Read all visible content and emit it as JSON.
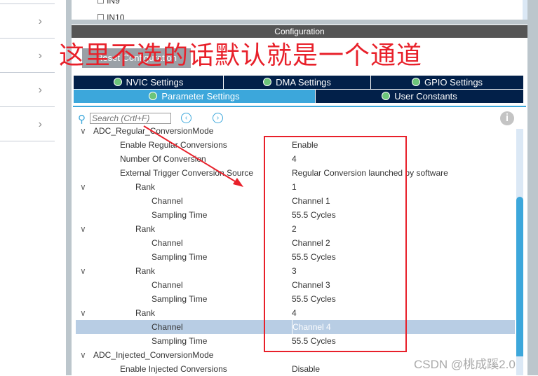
{
  "left_panel": {
    "items": [
      {
        "icon": "chevron-right"
      },
      {
        "icon": "chevron-right"
      },
      {
        "icon": "chevron-right"
      },
      {
        "icon": "chevron-right"
      }
    ]
  },
  "top_list": {
    "items": [
      "IN9",
      "IN10"
    ]
  },
  "config": {
    "title": "Configuration",
    "reset_button": "Reset Configuration"
  },
  "annotation": {
    "text": "这里不选的话默认就是一个通道",
    "color": "#e8202a"
  },
  "tabs": [
    {
      "label": "NVIC Settings"
    },
    {
      "label": "DMA Settings"
    },
    {
      "label": "GPIO Settings"
    },
    {
      "label": "Parameter Settings",
      "active": true
    },
    {
      "label": "User Constants"
    }
  ],
  "search": {
    "placeholder": "Search (Crtl+F)"
  },
  "rows": [
    {
      "key": "ADC_Regular_ConversionMode",
      "value": "",
      "level": 0,
      "toggle": true
    },
    {
      "key": "Enable Regular Conversions",
      "value": "Enable",
      "level": 1
    },
    {
      "key": "Number Of Conversion",
      "value": "4",
      "level": 1
    },
    {
      "key": "External Trigger Conversion Source",
      "value": "Regular Conversion launched by software",
      "level": 1
    },
    {
      "key": "Rank",
      "value": "1",
      "level": 2,
      "toggle": true
    },
    {
      "key": "Channel",
      "value": "Channel 1",
      "level": 3
    },
    {
      "key": "Sampling Time",
      "value": "55.5 Cycles",
      "level": 3
    },
    {
      "key": "Rank",
      "value": "2",
      "level": 2,
      "toggle": true
    },
    {
      "key": "Channel",
      "value": "Channel 2",
      "level": 3
    },
    {
      "key": "Sampling Time",
      "value": "55.5 Cycles",
      "level": 3
    },
    {
      "key": "Rank",
      "value": "3",
      "level": 2,
      "toggle": true
    },
    {
      "key": "Channel",
      "value": "Channel 3",
      "level": 3
    },
    {
      "key": "Sampling Time",
      "value": "55.5 Cycles",
      "level": 3
    },
    {
      "key": "Rank",
      "value": "4",
      "level": 2,
      "toggle": true
    },
    {
      "key": "Channel",
      "value": "Channel 4",
      "level": 3,
      "selected": true
    },
    {
      "key": "Sampling Time",
      "value": "55.5 Cycles",
      "level": 3
    },
    {
      "key": "ADC_Injected_ConversionMode",
      "value": "",
      "level": 0,
      "toggle": true
    },
    {
      "key": "Enable Injected Conversions",
      "value": "Disable",
      "level": 1
    }
  ],
  "watermark": "CSDN @桃成蹊2.0"
}
